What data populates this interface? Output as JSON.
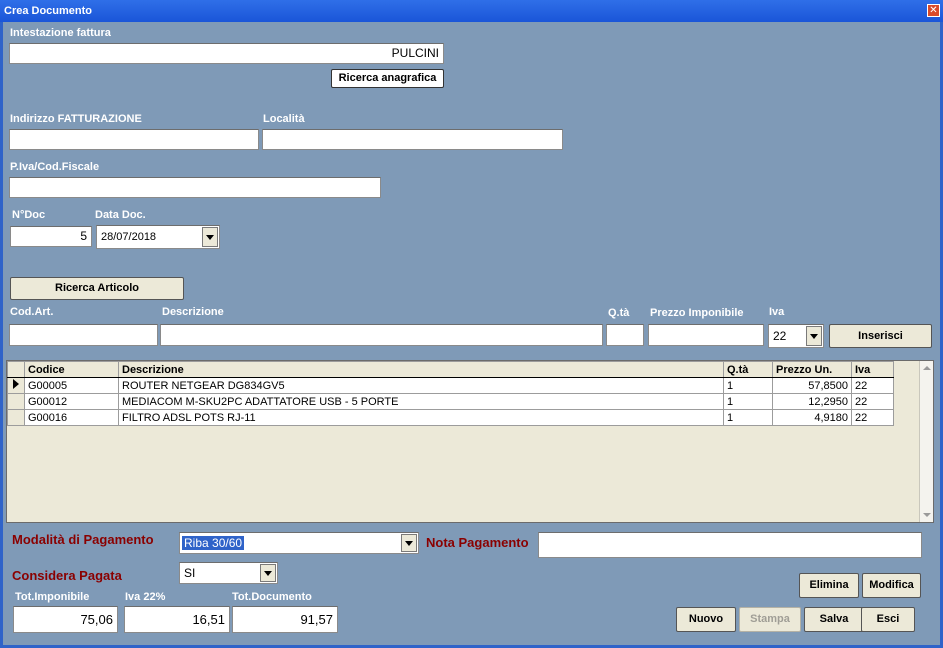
{
  "window": {
    "title": "Crea Documento"
  },
  "header": {
    "intestazione_label": "Intestazione fattura",
    "intestazione_value": "PULCINI",
    "ricerca_anagrafica": "Ricerca anagrafica",
    "indirizzo_label": "Indirizzo FATTURAZIONE",
    "indirizzo_value": "",
    "localita_label": "Località",
    "localita_value": "",
    "piva_label": "P.Iva/Cod.Fiscale",
    "piva_value": "",
    "ndoc_label": "N°Doc",
    "ndoc_value": "5",
    "datadoc_label": "Data Doc.",
    "datadoc_value": "28/07/2018"
  },
  "article": {
    "ricerca_articolo": "Ricerca Articolo",
    "codart_label": "Cod.Art.",
    "descrizione_label": "Descrizione",
    "qta_label": "Q.tà",
    "prezzo_label": "Prezzo Imponibile",
    "iva_label": "Iva",
    "iva_value": "22",
    "inserisci": "Inserisci"
  },
  "table": {
    "columns": [
      "Codice",
      "Descrizione",
      "Q.tà",
      "Prezzo Un.",
      "Iva"
    ],
    "rows": [
      {
        "codice": "G00005",
        "descrizione": "ROUTER NETGEAR DG834GV5",
        "qta": "1",
        "prezzo": "57,8500",
        "iva": "22"
      },
      {
        "codice": "G00012",
        "descrizione": "MEDIACOM M-SKU2PC ADATTATORE USB - 5 PORTE",
        "qta": "1",
        "prezzo": "12,2950",
        "iva": "22"
      },
      {
        "codice": "G00016",
        "descrizione": "FILTRO ADSL POTS RJ-11",
        "qta": "1",
        "prezzo": "4,9180",
        "iva": "22"
      }
    ]
  },
  "payment": {
    "modalita_label": "Modalità di Pagamento",
    "modalita_value": "Riba 30/60",
    "nota_label": "Nota Pagamento",
    "nota_value": "",
    "considera_label": "Considera Pagata",
    "considera_value": "SI"
  },
  "totals": {
    "imponibile_label": "Tot.Imponibile",
    "imponibile_value": "75,06",
    "iva_label": "Iva 22%",
    "iva_value": "16,51",
    "documento_label": "Tot.Documento",
    "documento_value": "91,57"
  },
  "buttons": {
    "elimina": "Elimina",
    "modifica": "Modifica",
    "nuovo": "Nuovo",
    "stampa": "Stampa",
    "salva": "Salva",
    "esci": "Esci"
  },
  "colors": {
    "background": "#7f9ab7",
    "titlebar": "#1a55d8",
    "accent_red": "#8a0000",
    "selection": "#2f63c9"
  }
}
